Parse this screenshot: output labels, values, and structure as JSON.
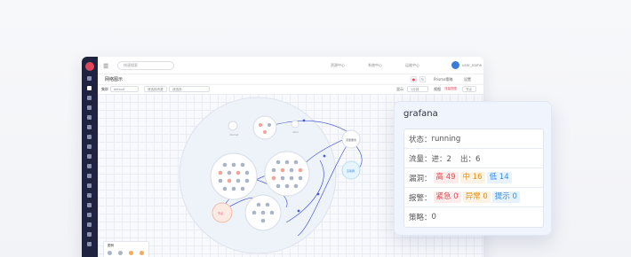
{
  "app": {
    "page_title": "网络图示",
    "search_placeholder": "快速搜索",
    "top_items": [
      "资源中心",
      "系统中心",
      "运维中心"
    ],
    "user": "user_name",
    "actions": [
      "Prisma策略",
      "设置"
    ]
  },
  "filter": {
    "label_env": "集群",
    "env_value": "default",
    "select_placeholder": "请选择资源",
    "select2_placeholder": "请选择",
    "label_view": "显示",
    "view_value": "1分钟",
    "label_type": "视图",
    "type_tag": "流量视图",
    "type_tag2": "节点"
  },
  "graph_labels": {
    "node_right1": "流量服务",
    "node_right2": "互联网",
    "node_left": "节点",
    "small1": "internet",
    "small2": "other"
  },
  "legend": {
    "title": "图例",
    "items": [
      "running",
      "pending",
      "failed",
      "unknown"
    ]
  },
  "colors": {
    "nav_bg": "#1f2340",
    "accent": "#e0475a",
    "edge": "#4a5bd4"
  },
  "card": {
    "title": "grafana",
    "status_label": "状态：",
    "status_value": "running",
    "traffic_label": "流量：",
    "traffic_in": "进：2",
    "traffic_out": "出：6",
    "vuln_label": "漏洞：",
    "vuln_high": "高 49",
    "vuln_mid": "中 16",
    "vuln_low": "低 14",
    "alert_label": "报警：",
    "alert_urgent": "紧急 0",
    "alert_abnormal": "异常 0",
    "alert_hint": "提示 0",
    "policy_label": "策略：",
    "policy_value": "0"
  }
}
